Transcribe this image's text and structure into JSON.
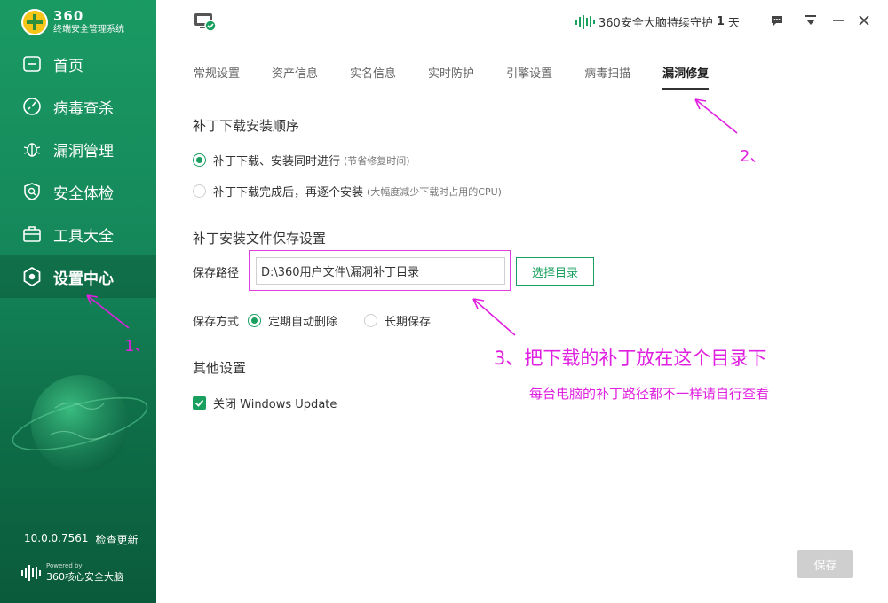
{
  "app": {
    "logo_main": "360",
    "logo_sub": "终端安全管理系统",
    "version": "10.0.0.7561",
    "update_label": "检查更新",
    "powered_by": "Powered by",
    "powered_name": "360核心安全大脑"
  },
  "sidebar": {
    "items": [
      {
        "label": "首页",
        "icon": "home-icon"
      },
      {
        "label": "病毒查杀",
        "icon": "scan-icon"
      },
      {
        "label": "漏洞管理",
        "icon": "bug-icon"
      },
      {
        "label": "安全体检",
        "icon": "shield-check-icon"
      },
      {
        "label": "工具大全",
        "icon": "toolbox-icon"
      },
      {
        "label": "设置中心",
        "icon": "settings-icon"
      }
    ],
    "active_index": 5
  },
  "header": {
    "protect_prefix": "360安全大脑持续守护",
    "protect_days": "1",
    "protect_suffix": "天"
  },
  "tabs": [
    "常规设置",
    "资产信息",
    "实名信息",
    "实时防护",
    "引擎设置",
    "病毒扫描",
    "漏洞修复"
  ],
  "active_tab": 6,
  "content": {
    "order_title": "补丁下载安装顺序",
    "order_opt1": "补丁下载、安装同时进行",
    "order_opt1_hint": "(节省修复时间)",
    "order_opt2": "补丁下载完成后，再逐个安装",
    "order_opt2_hint": "(大幅度减少下载时占用的CPU)",
    "file_title": "补丁安装文件保存设置",
    "path_label": "保存路径",
    "path_value": "D:\\360用户文件\\漏洞补丁目录",
    "choose_label": "选择目录",
    "mode_label": "保存方式",
    "mode_opt1": "定期自动删除",
    "mode_opt2": "长期保存",
    "other_title": "其他设置",
    "close_update": "关闭 Windows Update",
    "save_label": "保存"
  },
  "annotations": {
    "a1": "1、",
    "a2": "2、",
    "a3": "3、把下载的补丁放在这个目录下",
    "a4": "每台电脑的补丁路径都不一样请自行查看"
  },
  "colors": {
    "brand_green": "#19a05f",
    "sidebar_top": "#1a9a63",
    "annotation": "#e020e0"
  }
}
